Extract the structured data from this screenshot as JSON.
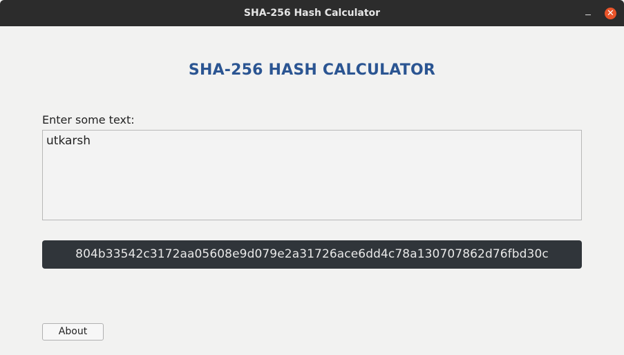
{
  "window": {
    "title": "SHA-256 Hash Calculator",
    "minimize_icon": "minimize-icon",
    "close_icon": "close-icon",
    "close_glyph": "✕"
  },
  "main": {
    "heading": "SHA-256 HASH CALCULATOR",
    "input_label": "Enter some text:",
    "input_value": "utkarsh",
    "hash_value": "804b33542c3172aa05608e9d079e2a31726ace6dd4c78a130707862d76fbd30c",
    "about_label": "About"
  },
  "colors": {
    "titlebar": "#2c2c2c",
    "close_button": "#e9542a",
    "heading": "#2b5592",
    "hash_background": "#30353a"
  }
}
